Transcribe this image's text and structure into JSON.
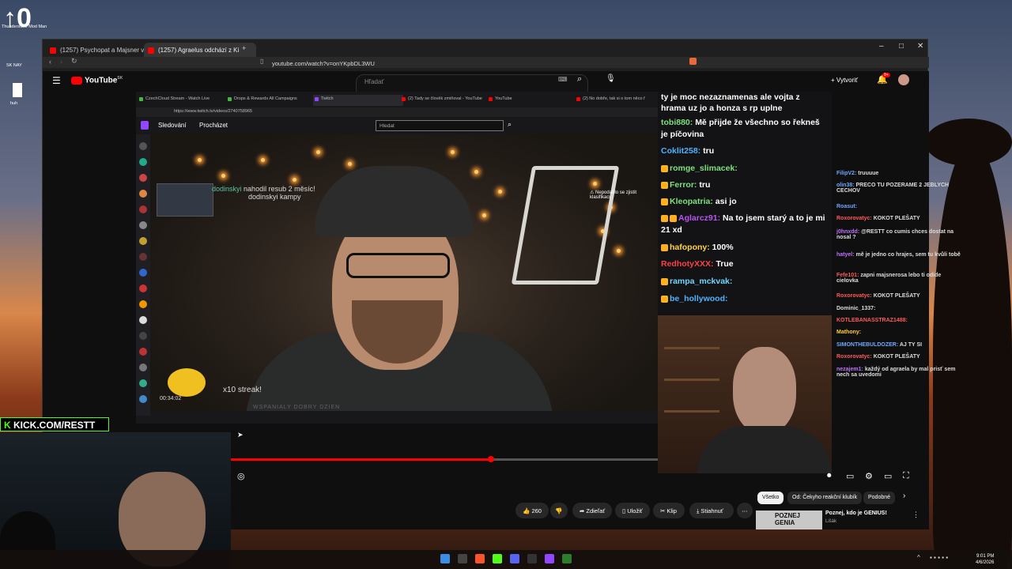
{
  "desktop": {
    "big_text": "↑0",
    "icon1_label": "Thunderstore Mod Man",
    "icon2_label": "SK NAY",
    "icon3_label": "huh"
  },
  "browser": {
    "tabs": [
      {
        "label": "(1257) Psychopat a Majsner vs pude"
      },
      {
        "label": "(1257) Agraelus odchází z Ki"
      }
    ],
    "new_tab": "+",
    "url": "youtube.com/watch?v=onYKpbDL3WU"
  },
  "youtube": {
    "logo": "YouTube",
    "logo_region": "SK",
    "search_placeholder": "Hľadať",
    "create_label": "Vytvoriť",
    "notif_count": "9+",
    "actions": {
      "likes": "260",
      "share": "Zdieľať",
      "save": "Uložiť",
      "clip": "Klip",
      "download": "Stiahnuť"
    },
    "chips": [
      "Všetko",
      "Od: Čekyho reakční klubík",
      "Podobné"
    ],
    "rec": {
      "title": "Poznej, kdo je GENIUS!",
      "channel": "Lišák",
      "thumb_top": "POZNEJ",
      "thumb_bottom": "GENIA"
    }
  },
  "inner_browser": {
    "tabs": [
      {
        "label": "CzechCloud Stream - Watch Live",
        "color": "#4bb543"
      },
      {
        "label": "Drops & Rewards All Campaigns",
        "color": "#4bb543"
      },
      {
        "label": "Twitch",
        "color": "#9146ff"
      },
      {
        "label": "(2) Tady se člověk zmiňoval - YouTube",
        "color": "#ff0000"
      },
      {
        "label": "YouTube",
        "color": "#ff0000"
      },
      {
        "label": "(2) No dobře, tak si o tom něco ř",
        "color": "#ff0000"
      }
    ],
    "url": "https://www.twitch.tv/videos/2740758965",
    "nav_following": "Sledování",
    "nav_browse": "Procházet",
    "search_placeholder": "Hledat",
    "warning": "Nepodařilo se zjistit klasifikaci",
    "sub_name": "dodinskyi",
    "sub_text": "nahodil resub 2 měsíc!",
    "sub_line2": "dodinskyi kampy",
    "streak": "x10 streak!",
    "timecode": "00:34:02",
    "watermark": "WSPANIALY DOBRY DZIEN"
  },
  "chat": [
    {
      "user": "",
      "text": "ty je moc nezaznamenas ale vojta z hrama uz jo a honza s rp uplne"
    },
    {
      "user": "tobi880:",
      "text": "Mě přijde že všechno so řekneš je píčovina"
    },
    {
      "user": "Coklit258:",
      "text": "tru"
    },
    {
      "user": "romge_slimacek:",
      "text": ""
    },
    {
      "user": "Ferror:",
      "text": "tru"
    },
    {
      "user": "Kleopatria:",
      "text": "asi jo"
    },
    {
      "user": "Aglarcz91:",
      "text": "Na to jsem starý a to je mi 21 xd"
    },
    {
      "user": "hafopony:",
      "text": "100%"
    },
    {
      "user": "RedhotyXXX:",
      "text": "True"
    },
    {
      "user": "rampa_mckvak:",
      "text": ""
    },
    {
      "user": "be_hollywood:",
      "text": ""
    }
  ],
  "small_chat": [
    {
      "user": "FilipV2:",
      "text": "truuuue"
    },
    {
      "user": "olin38:",
      "text": "PRECO TU POZERAME 2 JEBLYCH CECHOV"
    },
    {
      "user": "Roasut:",
      "text": ""
    },
    {
      "user": "Roxorovatyc:",
      "text": "KOKOT PLEŠATY"
    },
    {
      "user": "j0hnxdd:",
      "text": "@RESTT co cumis chces dostat na nosal ?"
    },
    {
      "user": "hatyel:",
      "text": "mě je jedno co hrajes, sem tu kvůli tobě"
    },
    {
      "user": "Fefe101:",
      "text": "zapni majsnerosa lebo ti odide cielovka"
    },
    {
      "user": "Roxorovatyc:",
      "text": "KOKOT PLEŠATY"
    },
    {
      "user": "Dominic_1337:",
      "text": ""
    },
    {
      "user": "KOTLEBANASSTRAZ1488:",
      "text": ""
    },
    {
      "user": "Mathony:",
      "text": ""
    },
    {
      "user": "SIMONTHEBULDOZER:",
      "text": "AJ TY SI"
    },
    {
      "user": "Roxorovatyc:",
      "text": "KOKOT PLEŠATY"
    },
    {
      "user": "nezajem1:",
      "text": "každý od agraela by mal prisť sem nech sa uvedomi"
    }
  ],
  "kick": {
    "label": "KICK.COM/RESTT"
  },
  "player": {
    "progress": 0.61
  },
  "taskbar": {
    "time": "9:01 PM",
    "date": "4/6/2026"
  }
}
